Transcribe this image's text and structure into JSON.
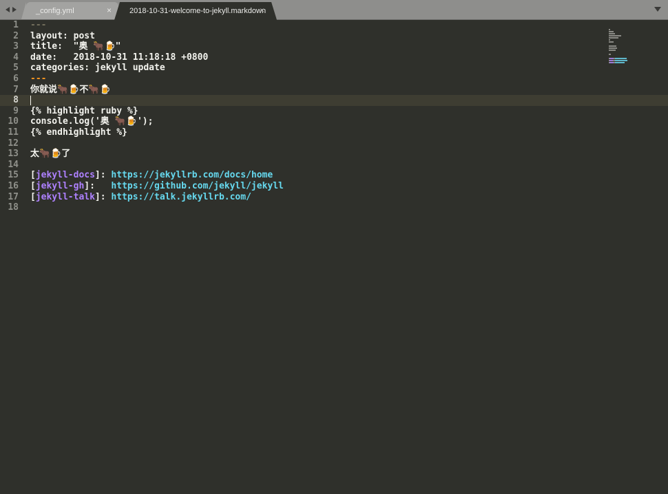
{
  "tabs": [
    {
      "label": "_config.yml",
      "close": "×",
      "active": false
    },
    {
      "label": "2018-10-31-welcome-to-jekyll.markdown",
      "close": "×",
      "active": true
    }
  ],
  "editor": {
    "current_line": 8,
    "lines": [
      {
        "num": "1",
        "segments": [
          {
            "t": "---",
            "c": "dashes"
          }
        ]
      },
      {
        "num": "2",
        "segments": [
          {
            "t": "layout: post",
            "c": ""
          }
        ]
      },
      {
        "num": "3",
        "segments": [
          {
            "t": "title:  \"奥 🐂🍺\"",
            "c": ""
          }
        ]
      },
      {
        "num": "4",
        "segments": [
          {
            "t": "date:   2018-10-31 11:18:18 +0800",
            "c": ""
          }
        ]
      },
      {
        "num": "5",
        "segments": [
          {
            "t": "categories: jekyll update",
            "c": ""
          }
        ]
      },
      {
        "num": "6",
        "segments": [
          {
            "t": "---",
            "c": "dashes-orange"
          }
        ]
      },
      {
        "num": "7",
        "segments": [
          {
            "t": "你就说🐂🍺不🐂🍺",
            "c": ""
          }
        ]
      },
      {
        "num": "8",
        "segments": []
      },
      {
        "num": "9",
        "segments": [
          {
            "t": "{% highlight ruby %}",
            "c": ""
          }
        ]
      },
      {
        "num": "10",
        "segments": [
          {
            "t": "console.log('奥 🐂🍺');",
            "c": ""
          }
        ]
      },
      {
        "num": "11",
        "segments": [
          {
            "t": "{% endhighlight %}",
            "c": ""
          }
        ]
      },
      {
        "num": "12",
        "segments": []
      },
      {
        "num": "13",
        "segments": [
          {
            "t": "太🐂🍺了",
            "c": ""
          }
        ]
      },
      {
        "num": "14",
        "segments": []
      },
      {
        "num": "15",
        "segments": [
          {
            "t": "[",
            "c": "punct"
          },
          {
            "t": "jekyll-docs",
            "c": "ref"
          },
          {
            "t": "]: ",
            "c": "punct"
          },
          {
            "t": "https://jekyllrb.com/docs/home",
            "c": "link"
          }
        ]
      },
      {
        "num": "16",
        "segments": [
          {
            "t": "[",
            "c": "punct"
          },
          {
            "t": "jekyll-gh",
            "c": "ref"
          },
          {
            "t": "]:   ",
            "c": "punct"
          },
          {
            "t": "https://github.com/jekyll/jekyll",
            "c": "link"
          }
        ]
      },
      {
        "num": "17",
        "segments": [
          {
            "t": "[",
            "c": "punct"
          },
          {
            "t": "jekyll-talk",
            "c": "ref"
          },
          {
            "t": "]: ",
            "c": "punct"
          },
          {
            "t": "https://talk.jekyllrb.com/",
            "c": "link"
          }
        ]
      },
      {
        "num": "18",
        "segments": []
      }
    ]
  },
  "icons": {
    "nav_back": "left-arrow-icon",
    "nav_forward": "right-arrow-icon",
    "tab_list": "dropdown-arrow-icon"
  },
  "colors": {
    "background": "#2f302b",
    "text": "#f3f3ee",
    "reference": "#ae81ff",
    "link": "#66d9ef",
    "front_matter_close": "#fd971f"
  }
}
